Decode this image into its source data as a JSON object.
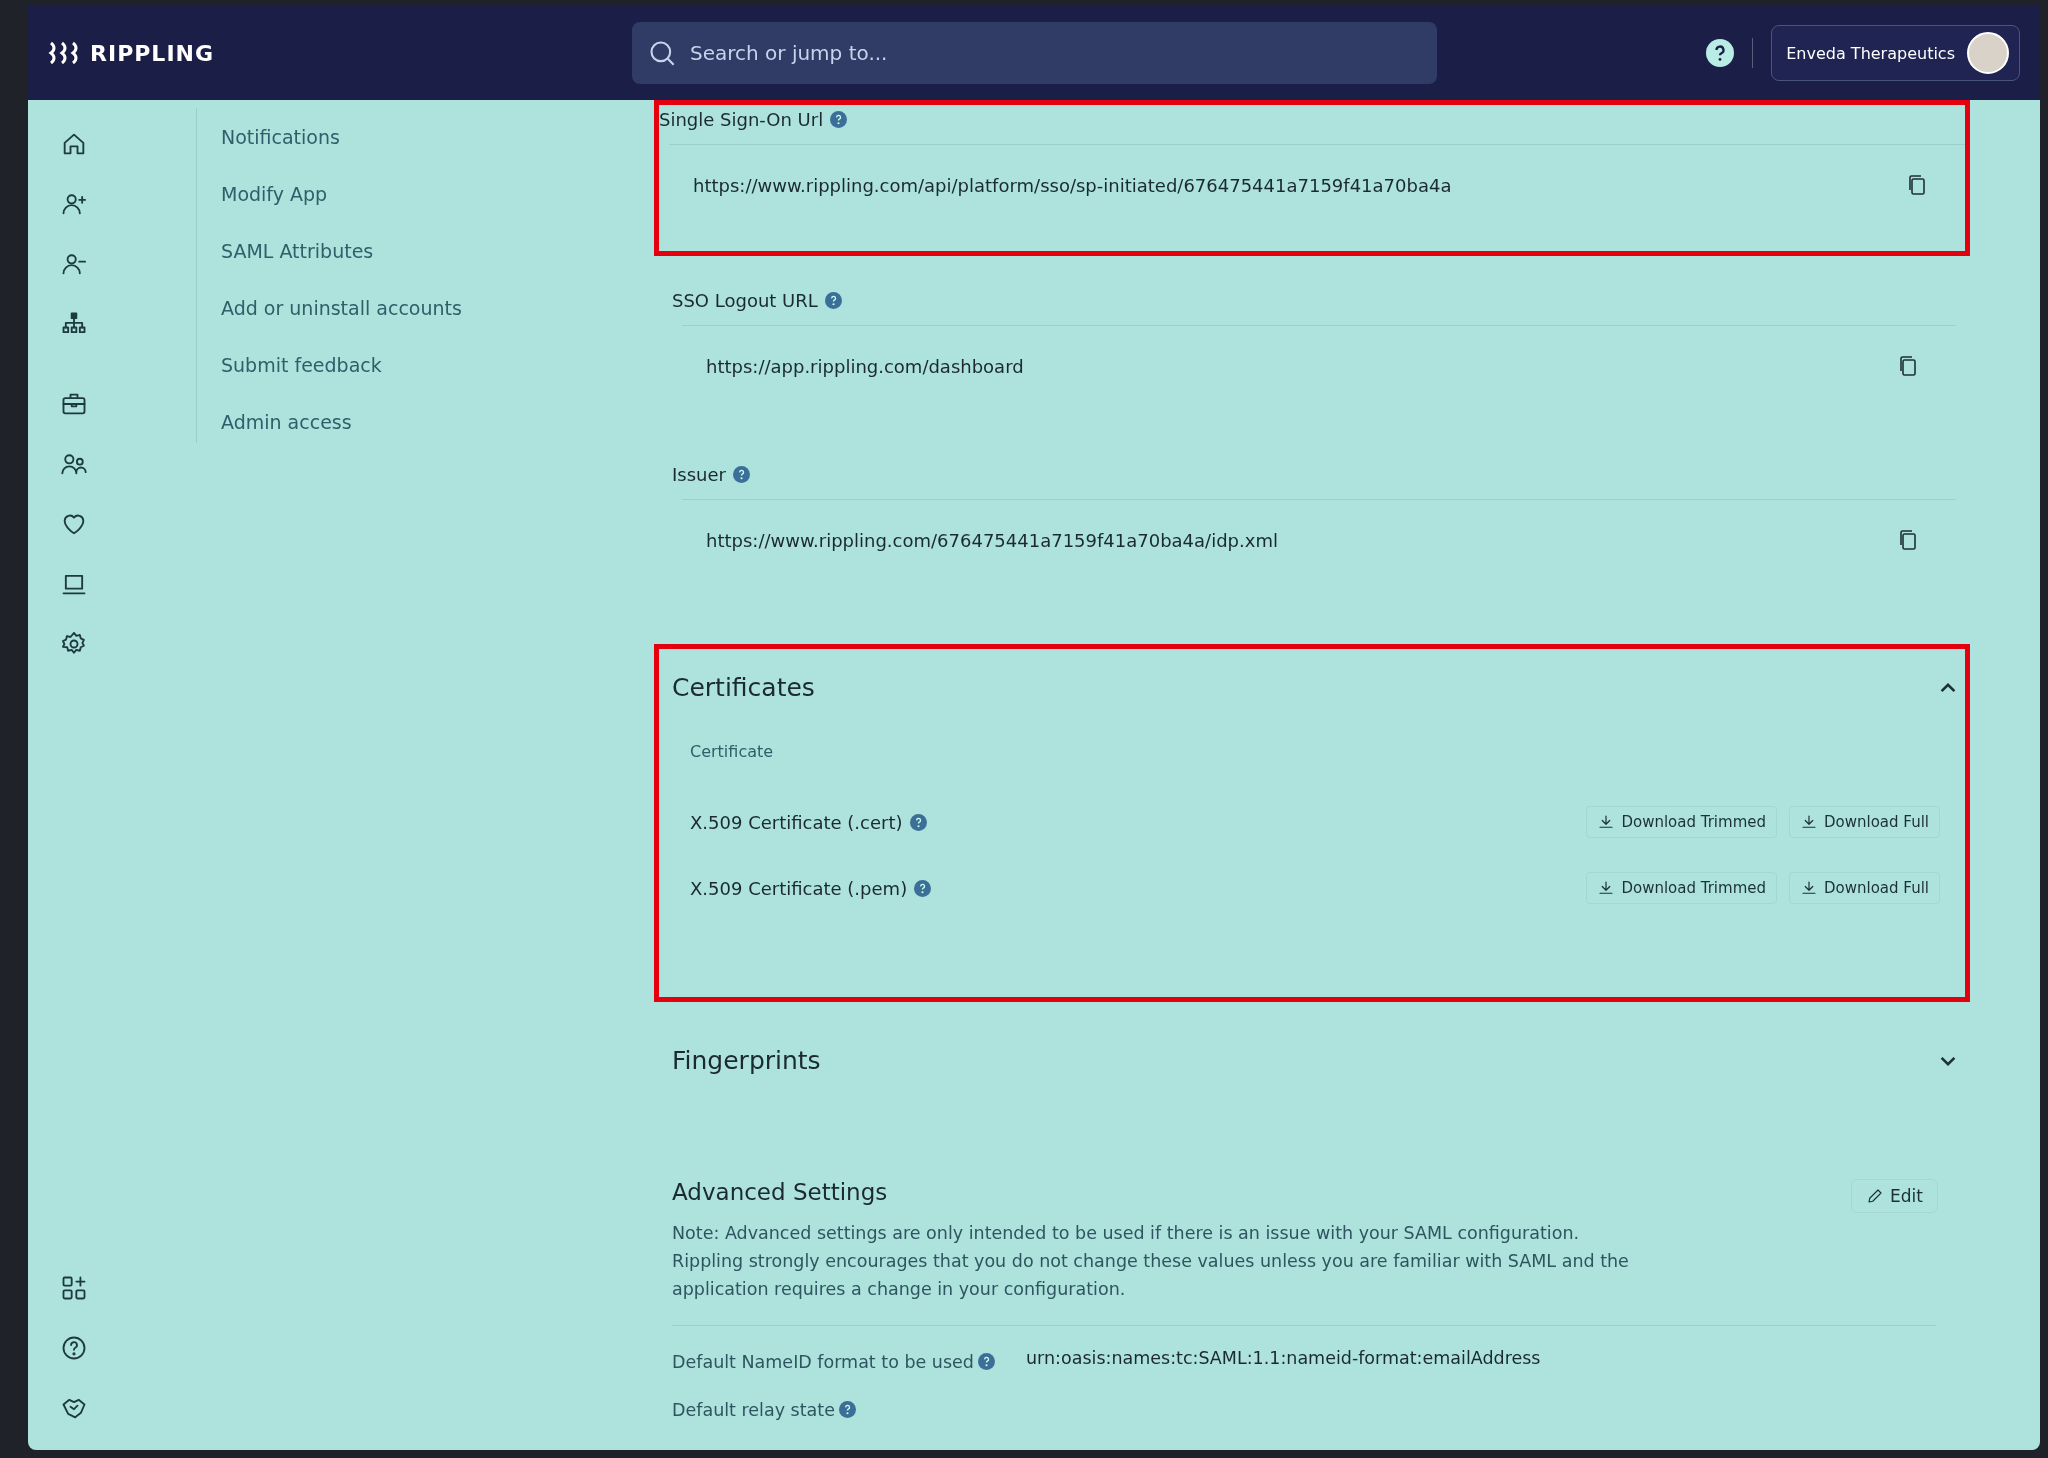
{
  "topbar": {
    "logo": "RIPPLING",
    "search": {
      "placeholder": "Search or jump to..."
    },
    "company": "Enveda Therapeutics"
  },
  "subnav": [
    {
      "label": "Notifications"
    },
    {
      "label": "Modify App"
    },
    {
      "label": "SAML Attributes"
    },
    {
      "label": "Add or uninstall accounts"
    },
    {
      "label": "Submit feedback"
    },
    {
      "label": "Admin access"
    }
  ],
  "fields": [
    {
      "label": "Single Sign-On Url",
      "value": "https://www.rippling.com/api/platform/sso/sp-initiated/676475441a7159f41a70ba4a",
      "highlighted": true
    },
    {
      "label": "SSO Logout URL",
      "value": "https://app.rippling.com/dashboard",
      "highlighted": false
    },
    {
      "label": "Issuer",
      "value": "https://www.rippling.com/676475441a7159f41a70ba4a/idp.xml",
      "highlighted": false
    }
  ],
  "certificates": {
    "title": "Certificates",
    "expanded": true,
    "highlighted": true,
    "column": "Certificate",
    "rows": [
      {
        "name": "X.509 Certificate (.cert)",
        "buttons": [
          "Download Trimmed",
          "Download Full"
        ]
      },
      {
        "name": "X.509 Certificate (.pem)",
        "buttons": [
          "Download Trimmed",
          "Download Full"
        ]
      }
    ]
  },
  "fingerprints": {
    "title": "Fingerprints",
    "expanded": false
  },
  "advanced": {
    "title": "Advanced Settings",
    "edit": "Edit",
    "note": "Note: Advanced settings are only intended to be used if there is an issue with your SAML configuration. Rippling strongly encourages that you do not change these values unless you are familiar with SAML and the application requires a change in your configuration.",
    "settings": [
      {
        "label": "Default NameID format to be used",
        "value": "urn:oasis:names:tc:SAML:1.1:nameid-format:emailAddress"
      },
      {
        "label": "Default relay state"
      }
    ]
  }
}
